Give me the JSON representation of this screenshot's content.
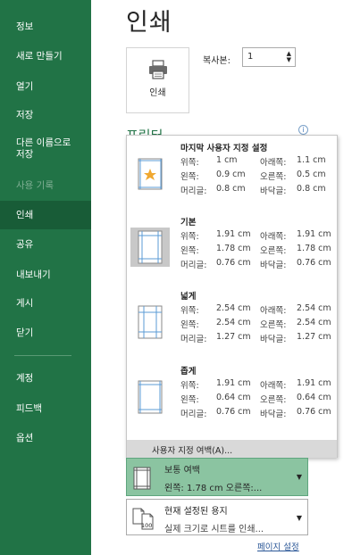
{
  "nav": {
    "items": [
      {
        "label": "정보",
        "state": "normal"
      },
      {
        "label": "새로 만들기",
        "state": "normal"
      },
      {
        "label": "열기",
        "state": "normal"
      },
      {
        "label": "저장",
        "state": "normal"
      },
      {
        "label": "다른 이름으로\n저장",
        "state": "normal"
      },
      {
        "label": "사용 기록",
        "state": "disabled"
      },
      {
        "label": "인쇄",
        "state": "selected"
      },
      {
        "label": "공유",
        "state": "normal"
      },
      {
        "label": "내보내기",
        "state": "normal"
      },
      {
        "label": "게시",
        "state": "normal"
      },
      {
        "label": "닫기",
        "state": "normal"
      },
      {
        "label": "계정",
        "state": "normal"
      },
      {
        "label": "피드백",
        "state": "normal"
      },
      {
        "label": "옵션",
        "state": "normal"
      }
    ]
  },
  "main": {
    "title": "인쇄",
    "print_button_label": "인쇄",
    "copies_label": "복사본:",
    "copies_value": "1",
    "printer_heading": "프린터"
  },
  "margins_dropdown": {
    "presets": [
      {
        "name": "마지막 사용자 지정 설정",
        "icon": "custom-margin-star-icon",
        "rows": [
          [
            "위쪽:",
            "1 cm",
            "아래쪽:",
            "1.1 cm"
          ],
          [
            "왼쪽:",
            "0.9 cm",
            "오른쪽:",
            "0.5 cm"
          ],
          [
            "머리글:",
            "0.8 cm",
            "바닥글:",
            "0.8 cm"
          ]
        ]
      },
      {
        "name": "기본",
        "icon": "normal-margin-icon",
        "rows": [
          [
            "위쪽:",
            "1.91 cm",
            "아래쪽:",
            "1.91 cm"
          ],
          [
            "왼쪽:",
            "1.78 cm",
            "오른쪽:",
            "1.78 cm"
          ],
          [
            "머리글:",
            "0.76 cm",
            "바닥글:",
            "0.76 cm"
          ]
        ]
      },
      {
        "name": "넓게",
        "icon": "wide-margin-icon",
        "rows": [
          [
            "위쪽:",
            "2.54 cm",
            "아래쪽:",
            "2.54 cm"
          ],
          [
            "왼쪽:",
            "2.54 cm",
            "오른쪽:",
            "2.54 cm"
          ],
          [
            "머리글:",
            "1.27 cm",
            "바닥글:",
            "1.27 cm"
          ]
        ]
      },
      {
        "name": "좁게",
        "icon": "narrow-margin-icon",
        "rows": [
          [
            "위쪽:",
            "1.91 cm",
            "아래쪽:",
            "1.91 cm"
          ],
          [
            "왼쪽:",
            "0.64 cm",
            "오른쪽:",
            "0.64 cm"
          ],
          [
            "머리글:",
            "0.76 cm",
            "바닥글:",
            "0.76 cm"
          ]
        ]
      }
    ],
    "custom_margins_label": "사용자 지정 여백(A)..."
  },
  "margin_setting": {
    "title": "보통 여백",
    "subtitle": "왼쪽:  1.78 cm   오른쪽:..."
  },
  "scale_setting": {
    "title": "현재 설정된 용지",
    "subtitle": "실제 크기로 시트를 인쇄...",
    "icon_text": "100"
  },
  "page_setup_link": "페이지 설정",
  "colors": {
    "sidebar": "#217346",
    "sidebar_selected": "#185c37",
    "selected_setting": "#8bc4a1",
    "link": "#2b5797"
  }
}
